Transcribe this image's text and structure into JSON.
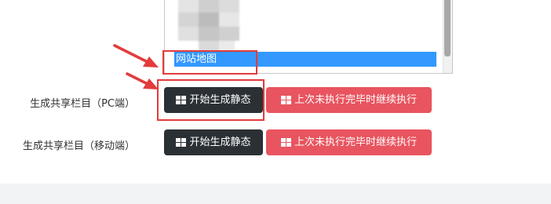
{
  "list": {
    "selected_option": "网站地图",
    "thumb_icon": "blurred-image-placeholder"
  },
  "rows": [
    {
      "label": "生成共享栏目（PC端）",
      "generate_button": "开始生成静态",
      "resume_button": "上次未执行完毕时继续执行"
    },
    {
      "label": "生成共享栏目（移动端）",
      "generate_button": "开始生成静态",
      "resume_button": "上次未执行完毕时继续执行"
    }
  ],
  "colors": {
    "dark_button": "#2b3035",
    "red_button": "#e8545f",
    "selection": "#3399ff",
    "annotation": "#e33b3b"
  },
  "icons": [
    "grid-icon",
    "annotation-arrow-icon"
  ]
}
